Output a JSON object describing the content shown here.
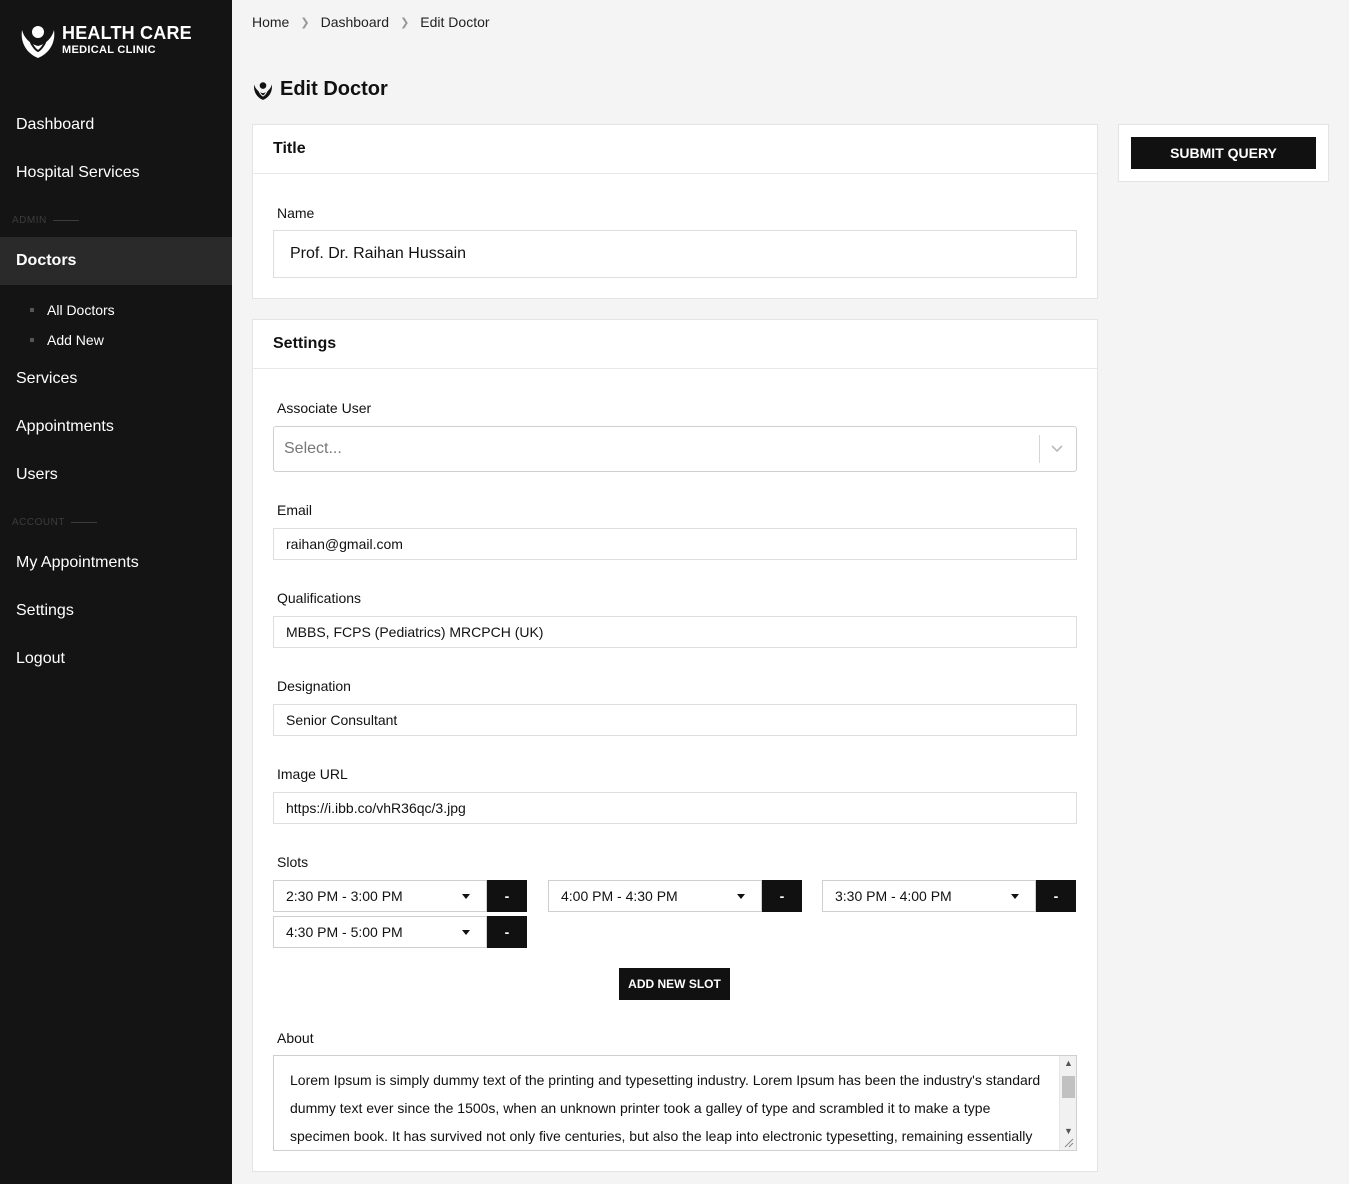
{
  "brand": {
    "line1": "HEALTH CARE",
    "line2": "MEDICAL CLINIC"
  },
  "sidebar": {
    "items_top": [
      {
        "label": "Dashboard"
      },
      {
        "label": "Hospital Services"
      }
    ],
    "section_admin": "ADMIN",
    "doctors": {
      "label": "Doctors"
    },
    "doctors_sub": [
      {
        "label": "All Doctors"
      },
      {
        "label": "Add New"
      }
    ],
    "items_admin": [
      {
        "label": "Services"
      },
      {
        "label": "Appointments"
      },
      {
        "label": "Users"
      }
    ],
    "section_account": "ACCOUNT",
    "items_account": [
      {
        "label": "My Appointments"
      },
      {
        "label": "Settings"
      },
      {
        "label": "Logout"
      }
    ]
  },
  "breadcrumb": [
    "Home",
    "Dashboard",
    "Edit Doctor"
  ],
  "page_title": "Edit Doctor",
  "title_card": {
    "header": "Title",
    "name_label": "Name",
    "name_value": "Prof. Dr. Raihan Hussain"
  },
  "settings_card": {
    "header": "Settings",
    "associate_user_label": "Associate User",
    "associate_user_placeholder": "Select...",
    "email_label": "Email",
    "email_value": "raihan@gmail.com",
    "qualifications_label": "Qualifications",
    "qualifications_value": "MBBS, FCPS (Pediatrics) MRCPCH (UK)",
    "designation_label": "Designation",
    "designation_value": "Senior Consultant",
    "image_url_label": "Image URL",
    "image_url_value": "https://i.ibb.co/vhR36qc/3.jpg",
    "slots_label": "Slots",
    "slots": [
      {
        "value": "2:30 PM - 3:00 PM",
        "remove": "-"
      },
      {
        "value": "4:00 PM - 4:30 PM",
        "remove": "-"
      },
      {
        "value": "3:30 PM - 4:00 PM",
        "remove": "-"
      },
      {
        "value": "4:30 PM - 5:00 PM",
        "remove": "-"
      }
    ],
    "add_slot_label": "ADD NEW SLOT",
    "about_label": "About",
    "about_value": "Lorem Ipsum is simply dummy text of the printing and typesetting industry. Lorem Ipsum has been the industry's standard dummy text ever since the 1500s, when an unknown printer took a galley of type and scrambled it to make a type specimen book. It has survived not only five centuries, but also the leap into electronic typesetting, remaining essentially unchanged. It was"
  },
  "submit_label": "SUBMIT QUERY"
}
